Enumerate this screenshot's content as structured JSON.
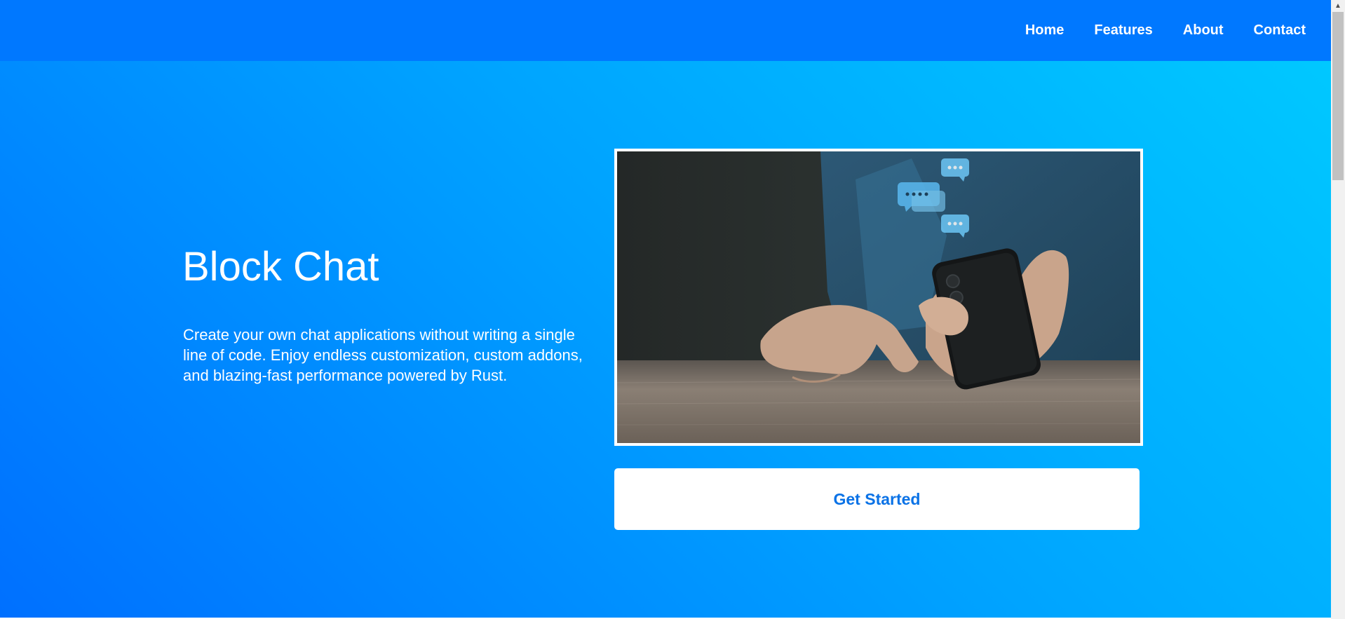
{
  "nav": {
    "items": [
      {
        "label": "Home"
      },
      {
        "label": "Features"
      },
      {
        "label": "About"
      },
      {
        "label": "Contact"
      }
    ]
  },
  "hero": {
    "title": "Block Chat",
    "description": "Create your own chat applications without writing a single line of code. Enjoy endless customization, custom addons, and blazing-fast performance powered by Rust.",
    "cta_label": "Get Started",
    "image_icon": "phone-chat-photo"
  },
  "colors": {
    "navbar": "#0078ff",
    "hero_gradient_start": "#0070ff",
    "hero_gradient_end": "#00c8ff",
    "cta_text": "#0a72e6"
  }
}
